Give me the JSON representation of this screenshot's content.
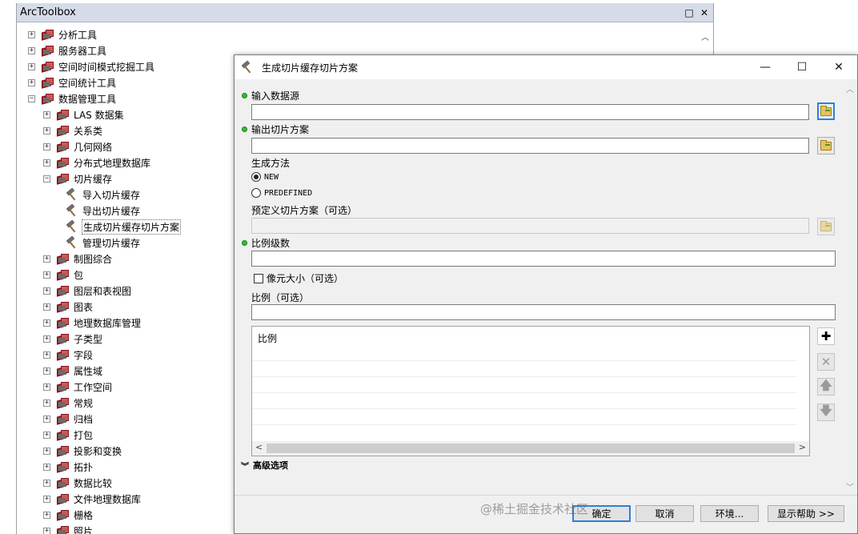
{
  "toolbox": {
    "title": "ArcToolbox",
    "restore_icon": "□",
    "close_icon": "✕",
    "tree": [
      {
        "label": "分析工具",
        "level": 0,
        "expanded": false,
        "icon": "toolbox-icon"
      },
      {
        "label": "服务器工具",
        "level": 0,
        "expanded": false,
        "icon": "toolbox-icon"
      },
      {
        "label": "空间时间模式挖掘工具",
        "level": 0,
        "expanded": false,
        "icon": "toolbox-icon"
      },
      {
        "label": "空间统计工具",
        "level": 0,
        "expanded": false,
        "icon": "toolbox-icon"
      },
      {
        "label": "数据管理工具",
        "level": 0,
        "expanded": true,
        "icon": "toolbox-icon"
      },
      {
        "label": "LAS 数据集",
        "level": 1,
        "expanded": false,
        "icon": "toolset-icon"
      },
      {
        "label": "关系类",
        "level": 1,
        "expanded": false,
        "icon": "toolset-icon"
      },
      {
        "label": "几何网络",
        "level": 1,
        "expanded": false,
        "icon": "toolset-icon"
      },
      {
        "label": "分布式地理数据库",
        "level": 1,
        "expanded": false,
        "icon": "toolset-icon"
      },
      {
        "label": "切片缓存",
        "level": 1,
        "expanded": true,
        "icon": "toolset-icon"
      },
      {
        "label": "导入切片缓存",
        "level": 2,
        "icon": "hammer-icon"
      },
      {
        "label": "导出切片缓存",
        "level": 2,
        "icon": "hammer-icon"
      },
      {
        "label": "生成切片缓存切片方案",
        "level": 2,
        "icon": "hammer-icon",
        "selected": true
      },
      {
        "label": "管理切片缓存",
        "level": 2,
        "icon": "hammer-icon"
      },
      {
        "label": "制图综合",
        "level": 1,
        "expanded": false,
        "icon": "toolset-icon"
      },
      {
        "label": "包",
        "level": 1,
        "expanded": false,
        "icon": "toolset-icon"
      },
      {
        "label": "图层和表视图",
        "level": 1,
        "expanded": false,
        "icon": "toolset-icon"
      },
      {
        "label": "图表",
        "level": 1,
        "expanded": false,
        "icon": "toolset-icon"
      },
      {
        "label": "地理数据库管理",
        "level": 1,
        "expanded": false,
        "icon": "toolset-icon"
      },
      {
        "label": "子类型",
        "level": 1,
        "expanded": false,
        "icon": "toolset-icon"
      },
      {
        "label": "字段",
        "level": 1,
        "expanded": false,
        "icon": "toolset-icon"
      },
      {
        "label": "属性域",
        "level": 1,
        "expanded": false,
        "icon": "toolset-icon"
      },
      {
        "label": "工作空间",
        "level": 1,
        "expanded": false,
        "icon": "toolset-icon"
      },
      {
        "label": "常规",
        "level": 1,
        "expanded": false,
        "icon": "toolset-icon"
      },
      {
        "label": "归档",
        "level": 1,
        "expanded": false,
        "icon": "toolset-icon"
      },
      {
        "label": "打包",
        "level": 1,
        "expanded": false,
        "icon": "toolset-icon"
      },
      {
        "label": "投影和变换",
        "level": 1,
        "expanded": false,
        "icon": "toolset-icon"
      },
      {
        "label": "拓扑",
        "level": 1,
        "expanded": false,
        "icon": "toolset-icon"
      },
      {
        "label": "数据比较",
        "level": 1,
        "expanded": false,
        "icon": "toolset-icon"
      },
      {
        "label": "文件地理数据库",
        "level": 1,
        "expanded": false,
        "icon": "toolset-icon"
      },
      {
        "label": "栅格",
        "level": 1,
        "expanded": false,
        "icon": "toolset-icon"
      },
      {
        "label": "照片",
        "level": 1,
        "expanded": false,
        "icon": "toolset-icon"
      }
    ]
  },
  "dialog": {
    "title": "生成切片缓存切片方案",
    "minimize_glyph": "—",
    "maximize_glyph": "☐",
    "close_glyph": "✕",
    "fields": {
      "input_source_label": "输入数据源",
      "input_source_value": "",
      "output_scheme_label": "输出切片方案",
      "output_scheme_value": "",
      "method_label": "生成方法",
      "method_new": "NEW",
      "method_predefined": "PREDEFINED",
      "method_selected": "NEW",
      "predefined_scheme_label": "预定义切片方案（可选）",
      "scale_levels_label": "比例级数",
      "scale_levels_value": "",
      "cell_size_label": "像元大小（可选）",
      "cell_size_checked": false,
      "scales_label": "比例（可选）",
      "scales_value": ""
    },
    "scale_table": {
      "header": "比例",
      "rows": [
        "",
        "",
        "",
        "",
        ""
      ]
    },
    "side_buttons": {
      "add": "✚",
      "remove": "✕",
      "up": "🡅",
      "down": "🡇"
    },
    "advanced_label": "高级选项",
    "footer": {
      "ok": "确定",
      "cancel": "取消",
      "env": "环境...",
      "help": "显示帮助 >>"
    }
  },
  "watermark": "@稀土掘金技术社区"
}
